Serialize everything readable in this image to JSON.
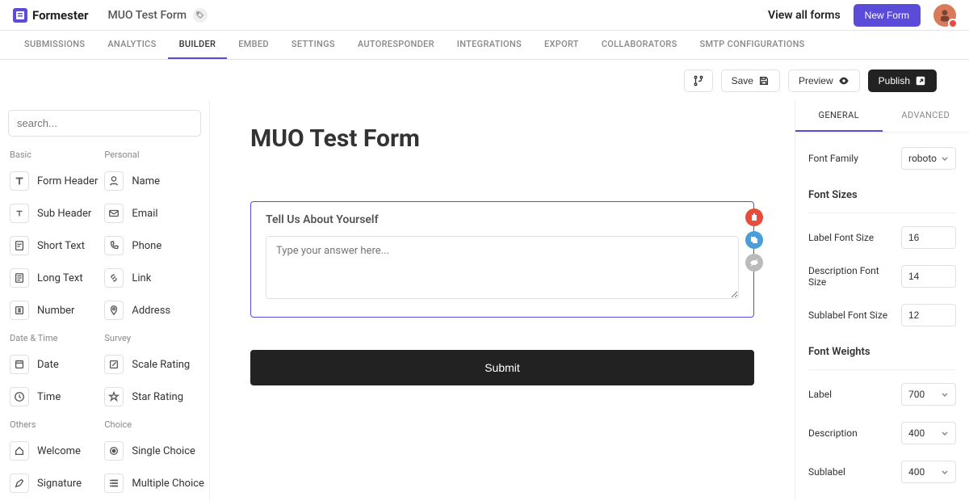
{
  "brand": {
    "name": "Formester"
  },
  "form": {
    "name": "MUO Test Form"
  },
  "header": {
    "view_all": "View all forms",
    "new_form": "New Form"
  },
  "nav": {
    "tabs": [
      {
        "label": "SUBMISSIONS"
      },
      {
        "label": "ANALYTICS"
      },
      {
        "label": "BUILDER"
      },
      {
        "label": "EMBED"
      },
      {
        "label": "SETTINGS"
      },
      {
        "label": "AUTORESPONDER"
      },
      {
        "label": "INTEGRATIONS"
      },
      {
        "label": "EXPORT"
      },
      {
        "label": "COLLABORATORS"
      },
      {
        "label": "SMTP CONFIGURATIONS"
      }
    ],
    "active_index": 2
  },
  "toolbar": {
    "save": "Save",
    "preview": "Preview",
    "publish": "Publish"
  },
  "left": {
    "search_placeholder": "search...",
    "groups": {
      "basic": "Basic",
      "personal": "Personal",
      "date_time": "Date & Time",
      "survey": "Survey",
      "others": "Others",
      "choice": "Choice"
    },
    "items": {
      "form_header": "Form Header",
      "sub_header": "Sub Header",
      "short_text": "Short Text",
      "long_text": "Long Text",
      "number": "Number",
      "name": "Name",
      "email": "Email",
      "phone": "Phone",
      "link": "Link",
      "address": "Address",
      "date": "Date",
      "time": "Time",
      "scale_rating": "Scale Rating",
      "star_rating": "Star Rating",
      "welcome": "Welcome",
      "signature": "Signature",
      "single_choice": "Single Choice",
      "multiple_choice": "Multiple Choice"
    }
  },
  "canvas": {
    "form_title": "MUO Test Form",
    "field_label": "Tell Us About Yourself",
    "field_placeholder": "Type your answer here...",
    "submit": "Submit"
  },
  "right": {
    "tabs": {
      "general": "GENERAL",
      "advanced": "ADVANCED"
    },
    "font_family_label": "Font Family",
    "font_family_value": "roboto",
    "font_sizes_heading": "Font Sizes",
    "label_font_size_label": "Label Font Size",
    "label_font_size_value": "16",
    "desc_font_size_label": "Description Font Size",
    "desc_font_size_value": "14",
    "sublabel_font_size_label": "Sublabel Font Size",
    "sublabel_font_size_value": "12",
    "font_weights_heading": "Font Weights",
    "weight_label_label": "Label",
    "weight_label_value": "700",
    "weight_desc_label": "Description",
    "weight_desc_value": "400",
    "weight_sublabel_label": "Sublabel",
    "weight_sublabel_value": "400"
  }
}
